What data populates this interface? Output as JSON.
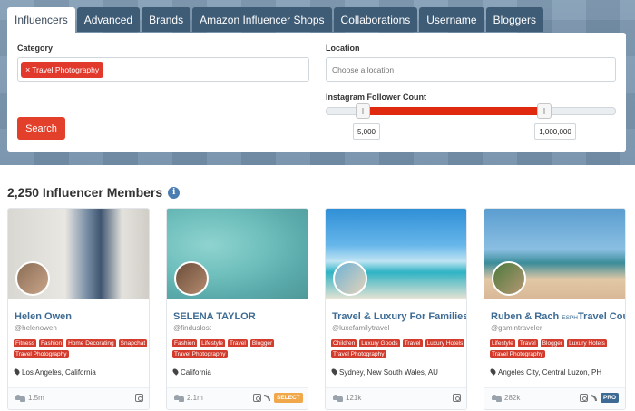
{
  "tabs": [
    "Influencers",
    "Advanced",
    "Brands",
    "Amazon Influencer Shops",
    "Collaborations",
    "Username",
    "Bloggers"
  ],
  "search": {
    "category_label": "Category",
    "category_chip": "Travel Photography",
    "chip_remove": "×",
    "location_label": "Location",
    "location_placeholder": "Choose a location",
    "followers_label": "Instagram Follower Count",
    "min_followers": "5,000",
    "max_followers": "1,000,000",
    "search_button": "Search"
  },
  "results_title": "2,250 Influencer Members",
  "info_glyph": "i",
  "cards": [
    {
      "name": "Helen Owen",
      "handle": "@helenowen",
      "tags": [
        "Fitness",
        "Fashion",
        "Home Decorating",
        "Snapchat",
        "Travel Photography"
      ],
      "location": "Los Angeles, California",
      "followers": "1.5m",
      "badge": ""
    },
    {
      "name": "SELENA TAYLOR",
      "handle": "@finduslost",
      "tags": [
        "Fashion",
        "Lifestyle",
        "Travel",
        "Blogger",
        "Travel Photography"
      ],
      "location": "California",
      "followers": "2.1m",
      "badge": "SELECT"
    },
    {
      "name": "Travel & Luxury For Families",
      "handle": "@luxefamilytravel",
      "tags": [
        "Children",
        "Luxury Goods",
        "Travel",
        "Luxury Hotels",
        "Travel Photography"
      ],
      "location": "Sydney, New South Wales, AU",
      "followers": "121k",
      "badge": ""
    },
    {
      "name": "Ruben & Rach",
      "name_suffix": "ESPH",
      "name_rest": "Travel Couple",
      "handle": "@gamintraveler",
      "tags": [
        "Lifestyle",
        "Travel",
        "Blogger",
        "Luxury Hotels",
        "Travel Photography"
      ],
      "location": "Angeles City, Central Luzon, PH",
      "followers": "282k",
      "badge": "PRO"
    }
  ],
  "colors": {
    "accent": "#e2392d",
    "tab_bg": "#3f5c77",
    "name_link": "#3d6b94"
  }
}
